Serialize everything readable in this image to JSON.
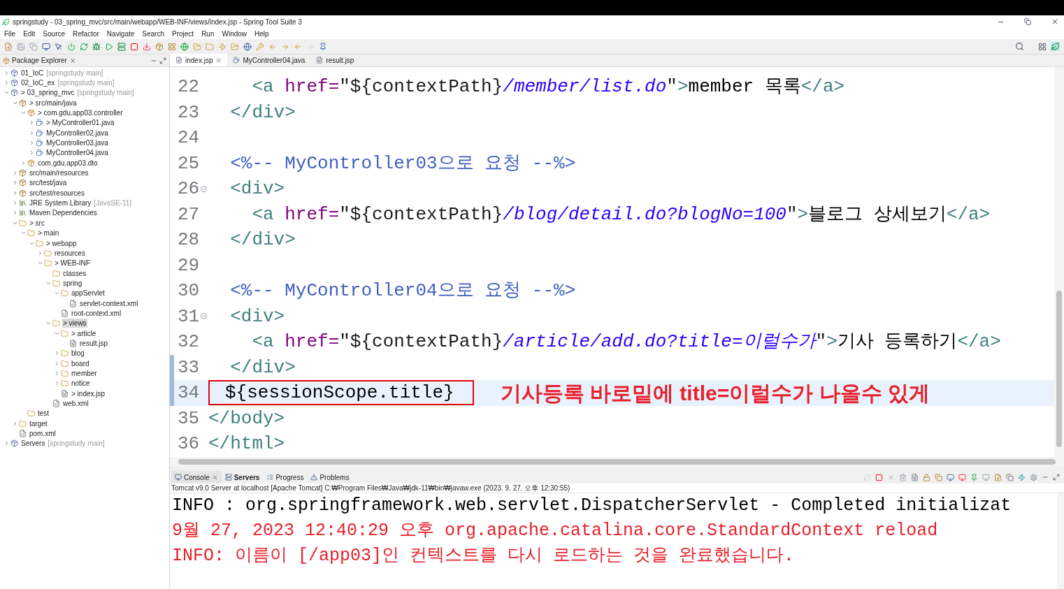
{
  "window": {
    "title": "springstudy - 03_spring_mvc/src/main/webapp/WEB-INF/views/index.jsp - Spring Tool Suite 3"
  },
  "menu": [
    "File",
    "Edit",
    "Source",
    "Refactor",
    "Navigate",
    "Search",
    "Project",
    "Run",
    "Window",
    "Help"
  ],
  "explorer": {
    "title": "Package Explorer",
    "tree": [
      {
        "label": "01_IoC",
        "repo": "[springstudy main]",
        "kind": "project",
        "expanded": false,
        "selected": false
      },
      {
        "label": "02_IoC_ex",
        "repo": "[springstudy main]",
        "kind": "project",
        "expanded": false,
        "selected": false
      },
      {
        "label": "> 03_spring_mvc",
        "repo": "[springstudy main]",
        "kind": "project",
        "expanded": true,
        "selected": false,
        "children": [
          {
            "label": "> src/main/java",
            "kind": "source",
            "expanded": true,
            "selected": false,
            "children": [
              {
                "label": "> com.gdu.app03.controller",
                "kind": "package",
                "expanded": true,
                "selected": false,
                "children": [
                  {
                    "label": "> MyController01.java",
                    "kind": "java",
                    "expanded": false,
                    "selected": false
                  },
                  {
                    "label": "MyController02.java",
                    "kind": "java",
                    "expanded": false,
                    "selected": false
                  },
                  {
                    "label": "MyController03.java",
                    "kind": "java",
                    "expanded": false,
                    "selected": false
                  },
                  {
                    "label": "MyController04.java",
                    "kind": "java",
                    "expanded": false,
                    "selected": false
                  }
                ]
              },
              {
                "label": "com.gdu.app03.dto",
                "kind": "package",
                "expanded": false,
                "selected": false
              }
            ]
          },
          {
            "label": "src/main/resources",
            "kind": "source",
            "expanded": false,
            "selected": false
          },
          {
            "label": "src/test/java",
            "kind": "source",
            "expanded": false,
            "selected": false
          },
          {
            "label": "src/test/resources",
            "kind": "source",
            "expanded": false,
            "selected": false
          },
          {
            "label": "JRE System Library",
            "repo": "[JavaSE-11]",
            "kind": "library",
            "expanded": false,
            "selected": false
          },
          {
            "label": "Maven Dependencies",
            "kind": "library",
            "expanded": false,
            "selected": false
          },
          {
            "label": "> src",
            "kind": "folder",
            "expanded": true,
            "selected": false,
            "children": [
              {
                "label": "> main",
                "kind": "folder",
                "expanded": true,
                "selected": false,
                "children": [
                  {
                    "label": "> webapp",
                    "kind": "folder",
                    "expanded": true,
                    "selected": false,
                    "children": [
                      {
                        "label": "resources",
                        "kind": "folder",
                        "expanded": false,
                        "selected": false
                      },
                      {
                        "label": "> WEB-INF",
                        "kind": "folder",
                        "expanded": true,
                        "selected": false,
                        "children": [
                          {
                            "label": "classes",
                            "kind": "folder",
                            "selected": false
                          },
                          {
                            "label": "spring",
                            "kind": "folder",
                            "expanded": true,
                            "selected": false,
                            "children": [
                              {
                                "label": "appServlet",
                                "kind": "folder",
                                "expanded": true,
                                "selected": false,
                                "children": [
                                  {
                                    "label": "servlet-context.xml",
                                    "kind": "xml",
                                    "selected": false
                                  }
                                ]
                              },
                              {
                                "label": "root-context.xml",
                                "kind": "xml",
                                "selected": false
                              }
                            ]
                          },
                          {
                            "label": "> views",
                            "kind": "folder",
                            "expanded": true,
                            "selected": true,
                            "children": [
                              {
                                "label": "> article",
                                "kind": "folder",
                                "expanded": true,
                                "selected": false,
                                "children": [
                                  {
                                    "label": "result.jsp",
                                    "kind": "jsp",
                                    "selected": false
                                  }
                                ]
                              },
                              {
                                "label": "blog",
                                "kind": "folder",
                                "expanded": false,
                                "selected": false
                              },
                              {
                                "label": "board",
                                "kind": "folder",
                                "expanded": false,
                                "selected": false
                              },
                              {
                                "label": "member",
                                "kind": "folder",
                                "expanded": false,
                                "selected": false
                              },
                              {
                                "label": "notice",
                                "kind": "folder",
                                "expanded": false,
                                "selected": false
                              },
                              {
                                "label": "> index.jsp",
                                "kind": "jsp",
                                "selected": false
                              }
                            ]
                          },
                          {
                            "label": "web.xml",
                            "kind": "xml",
                            "selected": false
                          }
                        ]
                      }
                    ]
                  }
                ]
              },
              {
                "label": "test",
                "kind": "folder",
                "selected": false
              }
            ]
          },
          {
            "label": "target",
            "kind": "folder",
            "expanded": false,
            "selected": false
          },
          {
            "label": "pom.xml",
            "kind": "xml",
            "selected": false
          }
        ]
      },
      {
        "label": "Servers",
        "repo": "[springstudy main]",
        "kind": "project",
        "expanded": false,
        "selected": false
      }
    ]
  },
  "editor": {
    "tabs": [
      {
        "label": "index.jsp",
        "kind": "jsp",
        "selected": true
      },
      {
        "label": "MyController04.java",
        "kind": "java",
        "selected": false
      },
      {
        "label": "result.jsp",
        "kind": "jsp",
        "selected": false
      }
    ],
    "lines": [
      {
        "number": "22",
        "fold": false,
        "changed": false,
        "current": false,
        "boxed": false,
        "segments": [
          {
            "kind": "tag",
            "text": "    <a "
          },
          {
            "kind": "attr",
            "text": "href="
          },
          {
            "kind": "el",
            "text": "\"${contextPath}"
          },
          {
            "kind": "value",
            "text": "/member/list.do"
          },
          {
            "kind": "el",
            "text": "\""
          },
          {
            "kind": "tag",
            "text": ">"
          },
          {
            "kind": "text",
            "text": "member 목록"
          },
          {
            "kind": "tag",
            "text": "</a>"
          }
        ]
      },
      {
        "number": "23",
        "fold": false,
        "changed": false,
        "current": false,
        "boxed": false,
        "segments": [
          {
            "kind": "tag",
            "text": "  </div>"
          }
        ]
      },
      {
        "number": "24",
        "fold": false,
        "changed": false,
        "current": false
      },
      {
        "number": "25",
        "fold": false,
        "changed": false,
        "current": false,
        "boxed": false,
        "segments": [
          {
            "kind": "comment",
            "text": "  <%-- MyController03으로 요청 --%>"
          }
        ]
      },
      {
        "number": "26",
        "fold": true,
        "changed": false,
        "current": false,
        "boxed": false,
        "segments": [
          {
            "kind": "tag",
            "text": "  <div>"
          }
        ]
      },
      {
        "number": "27",
        "fold": false,
        "changed": false,
        "current": false,
        "boxed": false,
        "segments": [
          {
            "kind": "tag",
            "text": "    <a "
          },
          {
            "kind": "attr",
            "text": "href="
          },
          {
            "kind": "el",
            "text": "\"${contextPath}"
          },
          {
            "kind": "value",
            "text": "/blog/detail.do?blogNo=100"
          },
          {
            "kind": "el",
            "text": "\""
          },
          {
            "kind": "tag",
            "text": ">"
          },
          {
            "kind": "text",
            "text": "블로그 상세보기"
          },
          {
            "kind": "tag",
            "text": "</a>"
          }
        ]
      },
      {
        "number": "28",
        "fold": false,
        "changed": false,
        "current": false,
        "boxed": false,
        "segments": [
          {
            "kind": "tag",
            "text": "  </div>"
          }
        ]
      },
      {
        "number": "29",
        "fold": false,
        "changed": false,
        "current": false
      },
      {
        "number": "30",
        "fold": false,
        "changed": false,
        "current": false,
        "boxed": false,
        "segments": [
          {
            "kind": "comment",
            "text": "  <%-- MyController04으로 요청 --%>"
          }
        ]
      },
      {
        "number": "31",
        "fold": true,
        "changed": false,
        "current": false,
        "boxed": false,
        "segments": [
          {
            "kind": "tag",
            "text": "  <div>"
          }
        ]
      },
      {
        "number": "32",
        "fold": false,
        "changed": false,
        "current": false,
        "boxed": false,
        "segments": [
          {
            "kind": "tag",
            "text": "    <a "
          },
          {
            "kind": "attr",
            "text": "href="
          },
          {
            "kind": "el",
            "text": "\"${contextPath}"
          },
          {
            "kind": "value",
            "text": "/article/add.do?title=이럴수가"
          },
          {
            "kind": "el",
            "text": "\""
          },
          {
            "kind": "tag",
            "text": ">"
          },
          {
            "kind": "text",
            "text": "기사 등록하기"
          },
          {
            "kind": "tag",
            "text": "</a>"
          }
        ]
      },
      {
        "number": "33",
        "fold": false,
        "changed": true,
        "current": false,
        "boxed": false,
        "segments": [
          {
            "kind": "tag",
            "text": "  </div>"
          }
        ]
      },
      {
        "number": "34",
        "fold": false,
        "changed": true,
        "current": true,
        "boxed": true,
        "note": "기사등록 바로밑에 title=이럴수가 나올수 있게",
        "segments": [
          {
            "kind": "text",
            "text": "${sessionScope.title}"
          }
        ]
      },
      {
        "number": "35",
        "fold": false,
        "changed": false,
        "current": false,
        "boxed": false,
        "segments": [
          {
            "kind": "tag",
            "text": "</body>"
          }
        ]
      },
      {
        "number": "36",
        "fold": false,
        "changed": false,
        "current": false,
        "boxed": false,
        "segments": [
          {
            "kind": "tag",
            "text": "</html>"
          }
        ]
      }
    ]
  },
  "console": {
    "tabs": [
      {
        "label": "Console",
        "selected": true,
        "bold": false
      },
      {
        "label": "Servers",
        "selected": false,
        "bold": true
      },
      {
        "label": "Progress",
        "selected": false,
        "bold": false
      },
      {
        "label": "Problems",
        "selected": false,
        "bold": false
      }
    ],
    "process": "Tomcat v9.0 Server at localhost [Apache Tomcat] C:₩Program Files₩Java₩jdk-11₩bin₩javaw.exe  (2023. 9. 27. 오후 12:30:55)",
    "lines": [
      {
        "kind": "out",
        "text": "INFO : org.springframework.web.servlet.DispatcherServlet - Completed initializat"
      },
      {
        "kind": "err",
        "text": "9월 27, 2023 12:40:29 오후 org.apache.catalina.core.StandardContext reload"
      },
      {
        "kind": "err",
        "text": "INFO: 이름이 [/app03]인 컨텍스트를 다시 로드하는 것을 완료했습니다."
      }
    ]
  }
}
